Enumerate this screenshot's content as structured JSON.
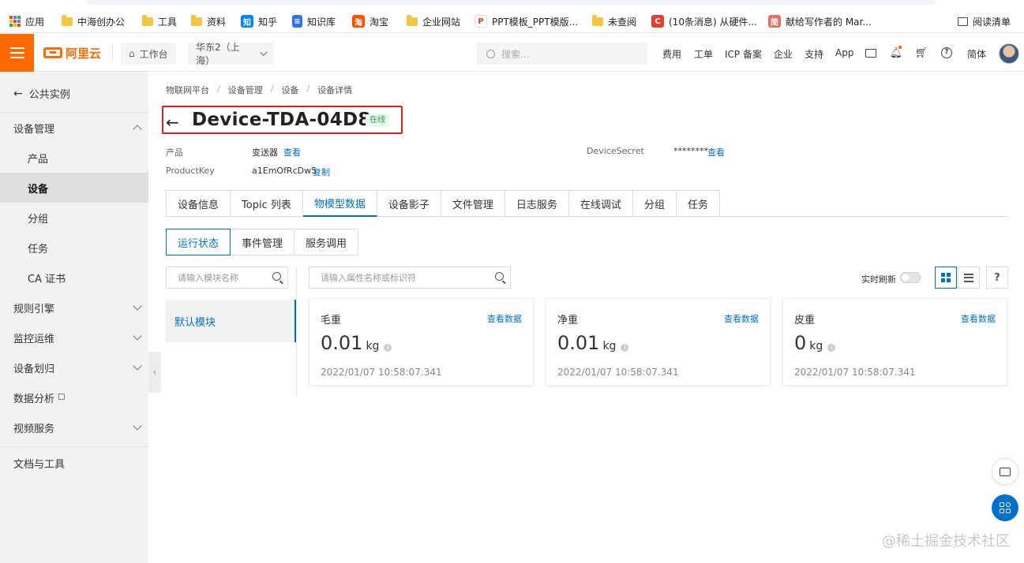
{
  "bookmarks": [
    {
      "label": "应用",
      "icon": "apps-grid-icon"
    },
    {
      "label": "中海创办公",
      "icon": "folder-icon"
    },
    {
      "label": "工具",
      "icon": "folder-icon"
    },
    {
      "label": "资料",
      "icon": "folder-icon"
    },
    {
      "label": "知乎",
      "icon": "zhihu-icon"
    },
    {
      "label": "知识库",
      "icon": "doc-icon"
    },
    {
      "label": "淘宝",
      "icon": "taobao-icon"
    },
    {
      "label": "企业网站",
      "icon": "folder-icon"
    },
    {
      "label": "PPT模板_PPT模版...",
      "icon": "ppt-icon"
    },
    {
      "label": "未查阅",
      "icon": "folder-icon"
    },
    {
      "label": "(10条消息) 从硬件...",
      "icon": "csdn-icon"
    },
    {
      "label": "献给写作者的 Mar...",
      "icon": "jianshu-icon"
    },
    {
      "label": "阅读清单",
      "icon": "reading-list-icon"
    }
  ],
  "topnav": {
    "logo": "阿里云",
    "workbench": "工作台",
    "region": "华东2（上海）",
    "search_placeholder": "搜索...",
    "links": [
      "费用",
      "工单",
      "ICP 备案",
      "企业",
      "支持",
      "App"
    ],
    "lang": "简体"
  },
  "sidebar": {
    "back_label": "公共实例",
    "items": [
      {
        "label": "设备管理",
        "level": 0,
        "expanded": true
      },
      {
        "label": "产品",
        "level": 1
      },
      {
        "label": "设备",
        "level": 1,
        "active": true
      },
      {
        "label": "分组",
        "level": 1
      },
      {
        "label": "任务",
        "level": 1
      },
      {
        "label": "CA 证书",
        "level": 1
      },
      {
        "label": "规则引擎",
        "level": 0
      },
      {
        "label": "监控运维",
        "level": 0
      },
      {
        "label": "设备划归",
        "level": 0
      },
      {
        "label": "数据分析",
        "level": 0,
        "external": true
      },
      {
        "label": "视频服务",
        "level": 0
      }
    ],
    "footer_label": "文档与工具"
  },
  "breadcrumb": [
    "物联网平台",
    "设备管理",
    "设备",
    "设备详情"
  ],
  "device": {
    "name": "Device-TDA-04D8",
    "status": "在线",
    "product_label": "产品",
    "product_value": "变送器",
    "product_link": "查看",
    "productkey_label": "ProductKey",
    "productkey_value": "a1EmOfRcDw5",
    "productkey_link": "复制",
    "secret_label": "DeviceSecret",
    "secret_value": "********",
    "secret_link": "查看"
  },
  "tabs": [
    "设备信息",
    "Topic 列表",
    "物模型数据",
    "设备影子",
    "文件管理",
    "日志服务",
    "在线调试",
    "分组",
    "任务"
  ],
  "active_tab": 2,
  "subtabs": [
    "运行状态",
    "事件管理",
    "服务调用"
  ],
  "module_search_placeholder": "请输入模块名称",
  "property_search_placeholder": "请输入属性名称或标识符",
  "modules": [
    "默认模块"
  ],
  "realtime_refresh_label": "实时刷新",
  "realtime_refresh_on": false,
  "view_help": "?",
  "cards": [
    {
      "name": "毛重",
      "link": "查看数据",
      "value": "0.01",
      "unit": "kg",
      "time": "2022/01/07 10:58:07.341"
    },
    {
      "name": "净重",
      "link": "查看数据",
      "value": "0.01",
      "unit": "kg",
      "time": "2022/01/07 10:58:07.341"
    },
    {
      "name": "皮重",
      "link": "查看数据",
      "value": "0",
      "unit": "kg",
      "time": "2022/01/07 10:58:07.341"
    }
  ],
  "watermark": "@稀土掘金技术社区",
  "colors": {
    "brand": "#ff6a00",
    "accent": "#0070cc",
    "online": "#2b9e5a",
    "highlight_box": "#e02020"
  }
}
